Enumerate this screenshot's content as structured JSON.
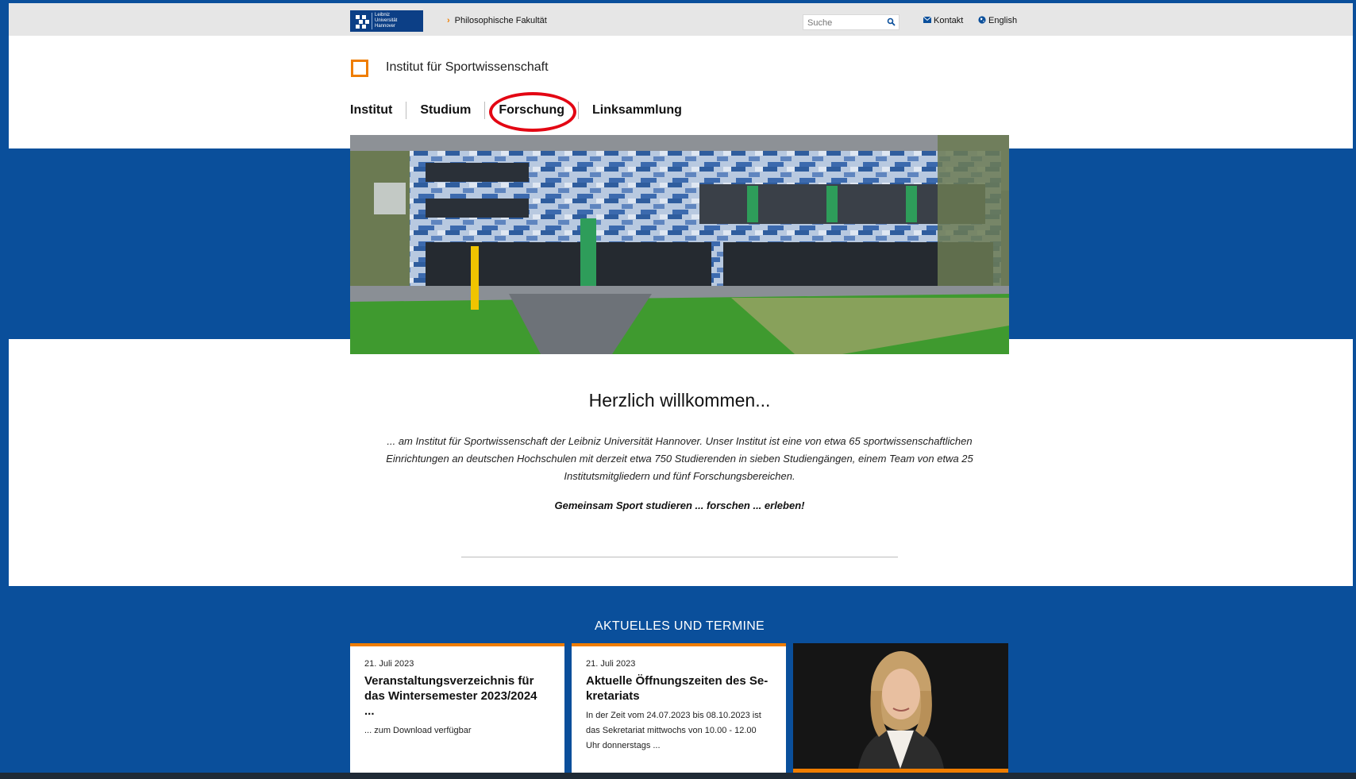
{
  "topbar": {
    "logo_lines": [
      "Leibniz",
      "Universität",
      "Hannover"
    ],
    "breadcrumb": "Philosophische Fakultät",
    "search_placeholder": "Suche",
    "contact": "Kontakt",
    "language": "English"
  },
  "header": {
    "institute": "Institut für Sportwissenschaft",
    "nav": [
      "Institut",
      "Studium",
      "Forschung",
      "Linksammlung"
    ]
  },
  "welcome": {
    "title": "Herzlich willkommen...",
    "text": "... am Institut für Sportwissenschaft der Leibniz Universität Hannover. Unser Institut ist eine von etwa 65 sportwissenschaftlichen Einrichtungen an deutschen Hochschulen mit derzeit etwa 750 Studierenden in sieben Studiengängen, einem Team von etwa 25 Institutsmitgliedern und fünf Forschungsbereichen.",
    "slogan": "Gemeinsam Sport studieren ... forschen ... erleben!"
  },
  "news": {
    "heading": "AKTUELLES UND TERMINE",
    "cards": [
      {
        "date": "21. Juli 2023",
        "title": "Veranstaltungsverzeichnis für das Wintersemester 2023/2024 ...",
        "body": "... zum Download verfügbar"
      },
      {
        "date": "21. Juli 2023",
        "title": "Aktuelle Öffnungszeiten des Se-kretariats",
        "body": "In der Zeit vom 24.07.2023 bis 08.10.2023 ist das Sekretariat mittwochs von 10.00 - 12.00 Uhr donnerstags ..."
      }
    ]
  },
  "colors": {
    "brand_blue": "#0a4f9b",
    "accent_orange": "#ef7d00",
    "highlight_red": "#e30613"
  },
  "icons": {
    "search": "search-icon",
    "contact": "mail-icon",
    "language": "globe-icon"
  }
}
